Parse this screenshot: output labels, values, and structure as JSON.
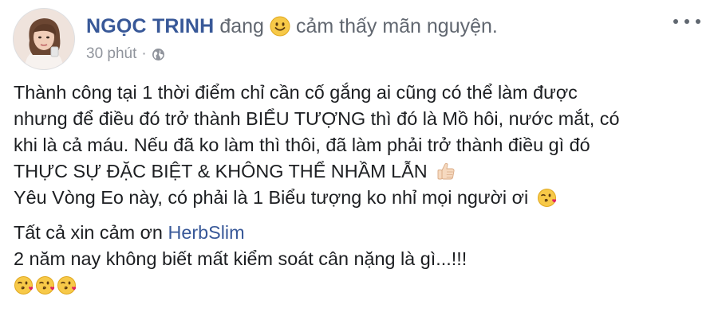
{
  "post": {
    "author": "NGỌC TRINH",
    "feeling_prefix": "đang",
    "feeling_icon": "smiley-icon",
    "feeling_text": "cảm thấy mãn nguyện.",
    "timestamp": "30 phút",
    "separator": "·",
    "privacy_icon": "globe-icon",
    "more_icon": "more-options-icon"
  },
  "content": {
    "lines": [
      "Thành công tại 1 thời điểm chỉ cần cố gắng ai cũng có thể làm được",
      "nhưng để điều đó trở thành BIỂU TƯỢNG thì đó là Mồ hôi, nước mắt, có",
      "khi là cả máu. Nếu đã ko làm thì thôi, đã làm phải trở thành điều gì đó",
      "THỰC SỰ ĐẶC BIỆT & KHÔNG THỂ NHẦM LẪN",
      "Yêu Vòng Eo này, có phải là 1 Biểu tượng ko nhỉ mọi người ơi"
    ],
    "thanks_prefix": "Tất cả xin cảm ơn",
    "thanks_link": "HerbSlim",
    "closing_line": "2 năm nay không biết mất kiểm soát cân nặng là gì...!!!",
    "line4_emoji": "thumbs-up-emoji",
    "line5_emoji": "face-blowing-kiss-emoji",
    "final_emojis": [
      "face-blowing-kiss-emoji",
      "face-blowing-kiss-emoji",
      "face-blowing-kiss-emoji"
    ]
  },
  "colors": {
    "author": "#385898",
    "link": "#385898",
    "meta_text": "#616770",
    "timestamp": "#90949c",
    "body_text": "#1c1e21"
  }
}
